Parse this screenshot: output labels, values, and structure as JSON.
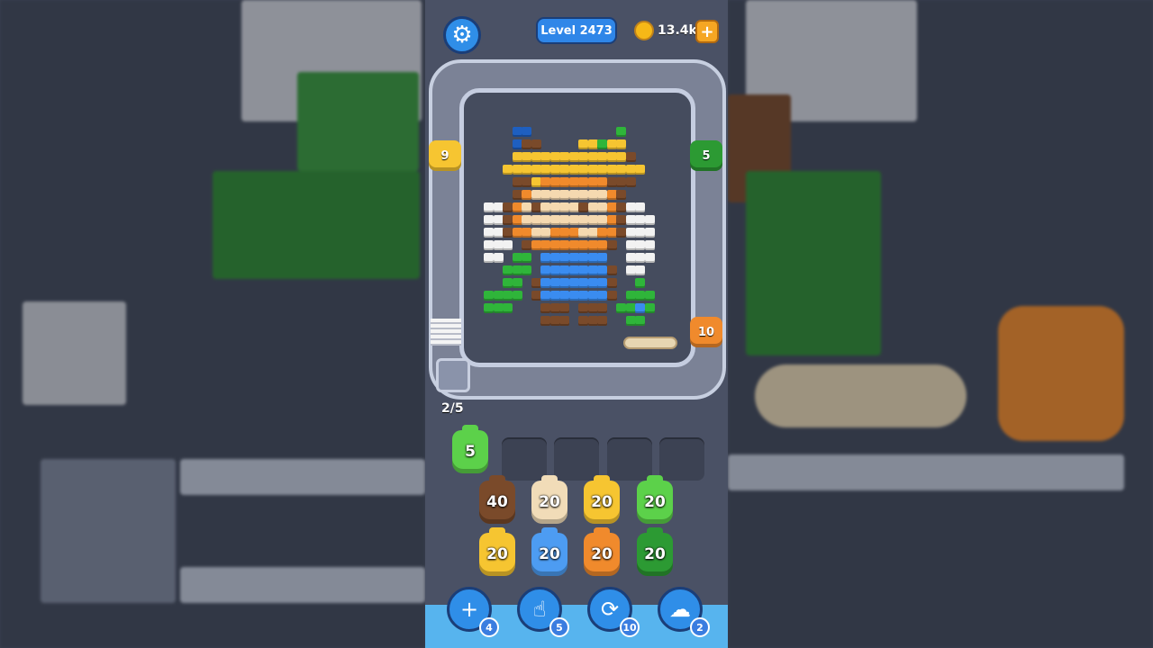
{
  "header": {
    "level_label": "Level 2473",
    "coins": "13.4k",
    "plus_label": "+"
  },
  "track": {
    "shooters": [
      {
        "id": "yellow",
        "count": "9",
        "color": "#f6c531"
      },
      {
        "id": "green",
        "count": "5",
        "color": "#2c9a33"
      },
      {
        "id": "orange",
        "count": "10",
        "color": "#f08a2c"
      }
    ]
  },
  "progress": {
    "label": "2/5"
  },
  "queue": {
    "active": {
      "count": "5",
      "color": "#5cd14a"
    },
    "empty_slots": 4
  },
  "grid": {
    "rows": [
      [
        {
          "count": "40",
          "color": "#7a4a2a"
        },
        {
          "count": "20",
          "color": "#f1dcb8"
        },
        {
          "count": "20",
          "color": "#f6c531"
        },
        {
          "count": "20",
          "color": "#5cd14a"
        }
      ],
      [
        {
          "count": "20",
          "color": "#f6c531"
        },
        {
          "count": "20",
          "color": "#4d9cf2"
        },
        {
          "count": "20",
          "color": "#f08a2c"
        },
        {
          "count": "20",
          "color": "#2c9a33"
        }
      ]
    ]
  },
  "boosters": [
    {
      "name": "add-slot-icon",
      "glyph": "+",
      "count": "4"
    },
    {
      "name": "hand-icon",
      "glyph": "☝",
      "count": "5"
    },
    {
      "name": "shuffle-icon",
      "glyph": "⟳",
      "count": "10"
    },
    {
      "name": "magnet-icon",
      "glyph": "☁",
      "count": "2"
    }
  ],
  "colors": {
    "accent": "#2f8ee8",
    "bottom_bar": "#57b4ee"
  }
}
